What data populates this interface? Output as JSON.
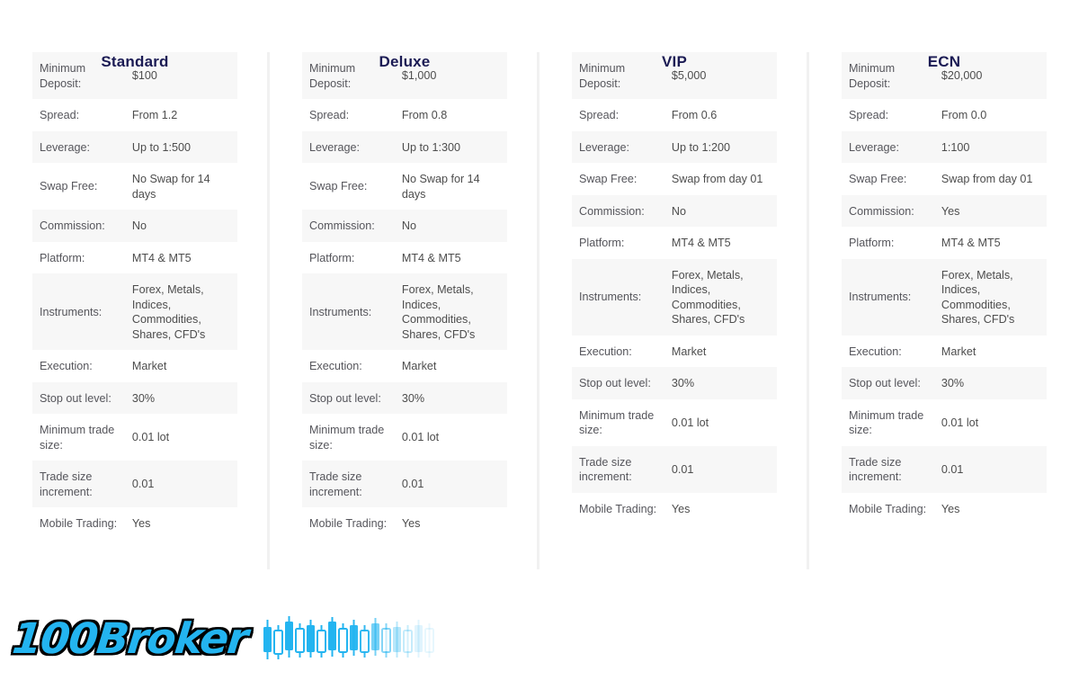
{
  "row_labels": [
    "Minimum Deposit:",
    "Spread:",
    "Leverage:",
    "Swap Free:",
    "Commission:",
    "Platform:",
    "Instruments:",
    "Execution:",
    "Stop out level:",
    "Minimum trade size:",
    "Trade size increment:",
    "Mobile Trading:"
  ],
  "plans": [
    {
      "title": "Standard",
      "values": [
        "$100",
        "From 1.2",
        "Up to 1:500",
        "No Swap for 14 days",
        "No",
        "MT4 & MT5",
        "Forex, Metals, Indices, Commodities, Shares, CFD's",
        "Market",
        "30%",
        "0.01 lot",
        "0.01",
        "Yes"
      ]
    },
    {
      "title": "Deluxe",
      "values": [
        "$1,000",
        "From 0.8",
        "Up to 1:300",
        "No Swap for 14 days",
        "No",
        "MT4 & MT5",
        "Forex, Metals, Indices, Commodities, Shares, CFD's",
        "Market",
        "30%",
        "0.01 lot",
        "0.01",
        "Yes"
      ]
    },
    {
      "title": "VIP",
      "values": [
        "$5,000",
        "From 0.6",
        "Up to 1:200",
        "Swap from day 01",
        "No",
        "MT4 & MT5",
        "Forex, Metals, Indices, Commodities, Shares, CFD's",
        "Market",
        "30%",
        "0.01 lot",
        "0.01",
        "Yes"
      ]
    },
    {
      "title": "ECN",
      "values": [
        "$20,000",
        "From 0.0",
        "1:100",
        "Swap from day 01",
        "Yes",
        "MT4 & MT5",
        "Forex, Metals, Indices, Commodities, Shares, CFD's",
        "Market",
        "30%",
        "0.01 lot",
        "0.01",
        "Yes"
      ]
    }
  ],
  "logo": {
    "text": "100Broker",
    "brand_color": "#23b4f0",
    "outline_color": "#000000",
    "candles_icon": "candlestick-chart-icon"
  },
  "colors": {
    "heading": "#1b1b54",
    "row_shaded": "#f7f7f7",
    "row_plain": "#ffffff",
    "divider": "#f1f1f1",
    "text": "#4d4d4d"
  }
}
